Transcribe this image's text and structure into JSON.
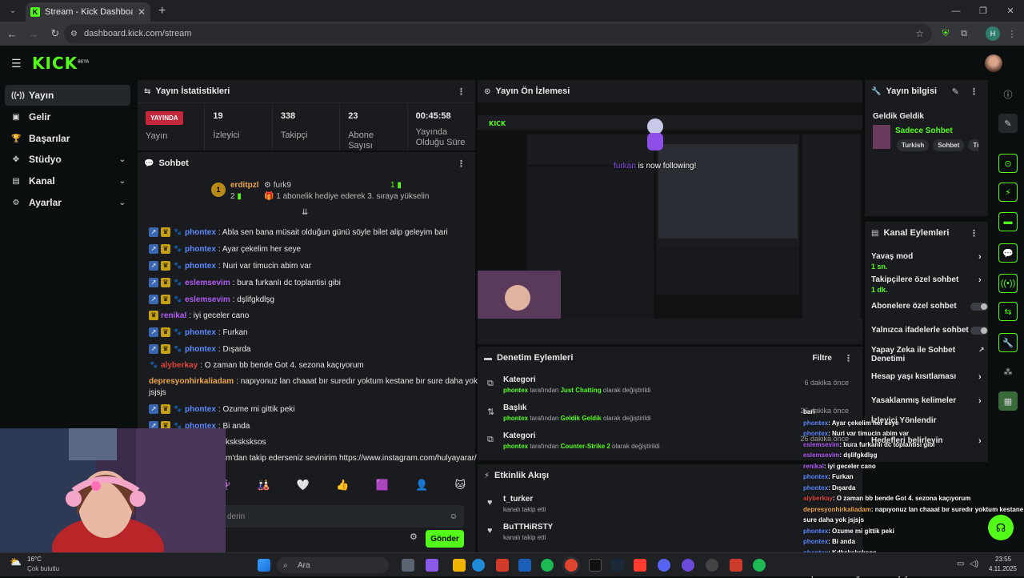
{
  "browser": {
    "tab_title": "Stream - Kick Dashboard",
    "url": "dashboard.kick.com/stream",
    "profile_initial": "H"
  },
  "brand": {
    "logo": "KICK",
    "beta": "BETA",
    "accent": "#53fc18"
  },
  "sidebar": {
    "items": [
      {
        "label": "Yayın",
        "icon": "broadcast-icon"
      },
      {
        "label": "Gelir",
        "icon": "revenue-icon"
      },
      {
        "label": "Başarılar",
        "icon": "trophy-icon"
      },
      {
        "label": "Stüdyo",
        "icon": "studio-icon"
      },
      {
        "label": "Kanal",
        "icon": "channel-icon"
      },
      {
        "label": "Ayarlar",
        "icon": "gear-icon"
      }
    ]
  },
  "stats_panel": {
    "title": "Yayın İstatistikleri",
    "live_badge": "YAYINDA",
    "live_label": "Yayın",
    "stats": [
      {
        "value": "19",
        "label": "İzleyici"
      },
      {
        "value": "338",
        "label": "Takipçi"
      },
      {
        "value": "23",
        "label": "Abone Sayısı"
      },
      {
        "value": "00:45:58",
        "label": "Yayında Olduğu Süre"
      }
    ]
  },
  "chat": {
    "title": "Sohbet",
    "pinned_user1": "erditpzl",
    "pinned_user2": "furk9",
    "pinned_rank": "1",
    "pinned_count1": "2",
    "pinned_count2": "1",
    "pinned_text": "1 abonelik hediye ederek 3. sıraya yükselin",
    "messages": [
      {
        "user": "phontex",
        "text": ": Abla sen bana müsait olduğun günü söyle bilet alip geleyim bari",
        "color": "#5d8cff",
        "badges": 3
      },
      {
        "user": "phontex",
        "text": ": Ayar çekelim her seye",
        "color": "#5d8cff",
        "badges": 3
      },
      {
        "user": "phontex",
        "text": ": Nuri var timucin abim var",
        "color": "#5d8cff",
        "badges": 3
      },
      {
        "user": "eslemsevim",
        "text": ": bura furkanlı dc toplantisi gibi",
        "color": "#b25cf2",
        "badges": 3
      },
      {
        "user": "eslemsevim",
        "text": ": dşlifgkdlşg",
        "color": "#b25cf2",
        "badges": 3
      },
      {
        "user": "renikal",
        "text": ": iyi geceler cano",
        "color": "#b25cf2",
        "badges": 1
      },
      {
        "user": "phontex",
        "text": ": Furkan",
        "color": "#5d8cff",
        "badges": 3
      },
      {
        "user": "phontex",
        "text": ": Dışarda",
        "color": "#5d8cff",
        "badges": 3
      },
      {
        "user": "alyberkay",
        "text": ": O zaman bb bende Got 4. sezona kaçıyorum",
        "color": "#e0463c",
        "badges": 1
      },
      {
        "user": "depresyonhirkaliadam",
        "text": ": napıyonuz lan chaaat bır suredır yoktum kestane bır sure daha yok",
        "color": "#f0a848",
        "badges": 0
      },
      {
        "user": "",
        "text": "jsjsjs",
        "color": "#e8e8e8",
        "badges": 0
      },
      {
        "user": "phontex",
        "text": ": Ozume mi gittik peki",
        "color": "#5d8cff",
        "badges": 3
      },
      {
        "user": "phontex",
        "text": ": Bi anda",
        "color": "#5d8cff",
        "badges": 3
      },
      {
        "user": "",
        "text": "ksksksksos",
        "color": "#e8e8e8",
        "badges": 0
      },
      {
        "user": "",
        "text": "m'dan takip ederseniz sevinirim https://www.instagram.com/hulyayarar/",
        "color": "#e8e8e8",
        "badges": 0
      }
    ],
    "input_placeholder": "derin",
    "send_label": "Gönder"
  },
  "preview_panel": {
    "title": "Yayın Ön İzlemesi",
    "follow_user": "furkan",
    "follow_text": "is now following!"
  },
  "moderation": {
    "title": "Denetim Eylemleri",
    "filter_label": "Filtre",
    "rows": [
      {
        "title": "Kategori",
        "user": "phontex",
        "mid": " tarafından ",
        "value": "Just Chatting",
        "tail": " olarak değiştirildi",
        "time": "6 dakika önce",
        "icon": "category-icon"
      },
      {
        "title": "Başlık",
        "user": "phontex",
        "mid": " tarafından ",
        "value": "Geldik Geldik",
        "tail": " olarak değiştirildi",
        "time": "26 dakika önce",
        "icon": "title-icon"
      },
      {
        "title": "Kategori",
        "user": "phontex",
        "mid": " tarafından ",
        "value": "Counter-Strike 2",
        "tail": " olarak değiştirildi",
        "time": "26 dakika önce",
        "icon": "category-icon"
      }
    ]
  },
  "activity": {
    "title": "Etkinlik Akışı",
    "rows": [
      {
        "user": "t_turker",
        "text": "kanalı takip etti"
      },
      {
        "user": "BuTTHiRSTY",
        "text": "kanalı takip etti"
      }
    ]
  },
  "stream_info": {
    "title": "Yayın bilgisi",
    "stream_title": "Geldik Geldik",
    "category": "Sadece Sohbet",
    "tags": [
      "Turkish",
      "Sohbet",
      "Tür"
    ]
  },
  "channel_actions": {
    "title": "Kanal Eylemleri",
    "rows": [
      {
        "label": "Yavaş mod",
        "sub": "1 sn.",
        "kind": "arrow"
      },
      {
        "label": "Takipçilere özel sohbet",
        "sub": "1 dk.",
        "kind": "arrow"
      },
      {
        "label": "Abonelere özel sohbet",
        "sub": "",
        "kind": "toggle"
      },
      {
        "label": "Yalnızca ifadelerle sohbet",
        "sub": "",
        "kind": "toggle"
      },
      {
        "label": "Yapay Zeka ile Sohbet Denetimi",
        "sub": "",
        "kind": "external"
      },
      {
        "label": "Hesap yaşı kısıtlaması",
        "sub": "",
        "kind": "arrow"
      },
      {
        "label": "Yasaklanmış kelimeler",
        "sub": "",
        "kind": "arrow"
      },
      {
        "label": "İzleyici Yönlendir",
        "sub": "",
        "kind": "none"
      },
      {
        "label": "Hedefleri belirleyin",
        "sub": "",
        "kind": "arrow"
      }
    ]
  },
  "overlay_chat": [
    {
      "user": "",
      "text": "bari"
    },
    {
      "user": "phontex",
      "text": ": Ayar çekelim her seye"
    },
    {
      "user": "phontex",
      "text": ": Nuri var timucin abim var"
    },
    {
      "user": "eslemsevim",
      "text": ": bura furkanlı dc toplantısı gibi"
    },
    {
      "user": "eslemsevim",
      "text": ": dşlifgkdlşg"
    },
    {
      "user": "renikal",
      "text": ": iyi geceler cano"
    },
    {
      "user": "phontex",
      "text": ": Furkan"
    },
    {
      "user": "phontex",
      "text": ": Dışarda"
    },
    {
      "user": "alyberkay",
      "text": ": O zaman bb bende Got 4. sezona kaçıyorum"
    },
    {
      "user": "depresyonhirkaliadam",
      "text": ": napıyonuz lan chaaat bır suredır yoktum kestane bır"
    },
    {
      "user": "",
      "text": "sure daha yok jsjsjs"
    },
    {
      "user": "phontex",
      "text": ": Ozume mi gittik peki"
    },
    {
      "user": "phontex",
      "text": ": Bi anda"
    },
    {
      "user": "phontex",
      "text": ": Kdksksksksos"
    },
    {
      "user": "BotRix",
      "text": ": Instagram'dan takip ederseniz sevinirim"
    },
    {
      "user": "",
      "text": "https://www.instagram.com/hulyayarar/"
    }
  ],
  "taskbar": {
    "weather_temp": "16°C",
    "weather_desc": "Çok bulutlu",
    "search_label": "Ara",
    "time": "23:55",
    "date": "4.11.2025"
  }
}
